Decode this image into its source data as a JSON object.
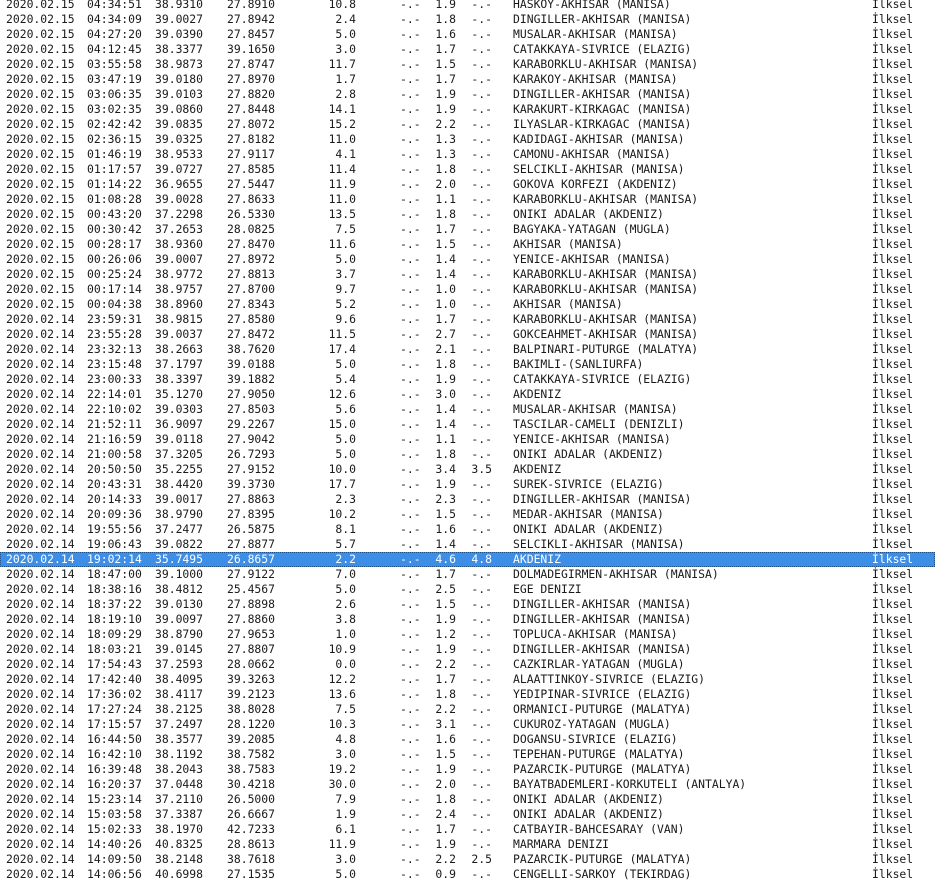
{
  "rows": [
    {
      "date": "2020.02.15",
      "time": "04:34:51",
      "lat": "38.9310",
      "lon": "27.8910",
      "depth": "10.8",
      "md": "-.-",
      "ml": "1.9",
      "mw": "-.-",
      "location": "HASKOY-AKHISAR (MANISA)",
      "type": "İlksel"
    },
    {
      "date": "2020.02.15",
      "time": "04:34:09",
      "lat": "39.0027",
      "lon": "27.8942",
      "depth": "2.4",
      "md": "-.-",
      "ml": "1.8",
      "mw": "-.-",
      "location": "DINGILLER-AKHISAR (MANISA)",
      "type": "İlksel"
    },
    {
      "date": "2020.02.15",
      "time": "04:27:20",
      "lat": "39.0390",
      "lon": "27.8457",
      "depth": "5.0",
      "md": "-.-",
      "ml": "1.6",
      "mw": "-.-",
      "location": "MUSALAR-AKHISAR (MANISA)",
      "type": "İlksel"
    },
    {
      "date": "2020.02.15",
      "time": "04:12:45",
      "lat": "38.3377",
      "lon": "39.1650",
      "depth": "3.0",
      "md": "-.-",
      "ml": "1.7",
      "mw": "-.-",
      "location": "CATAKKAYA-SIVRICE (ELAZIG)",
      "type": "İlksel"
    },
    {
      "date": "2020.02.15",
      "time": "03:55:58",
      "lat": "38.9873",
      "lon": "27.8747",
      "depth": "11.7",
      "md": "-.-",
      "ml": "1.5",
      "mw": "-.-",
      "location": "KARABORKLU-AKHISAR (MANISA)",
      "type": "İlksel"
    },
    {
      "date": "2020.02.15",
      "time": "03:47:19",
      "lat": "39.0180",
      "lon": "27.8970",
      "depth": "1.7",
      "md": "-.-",
      "ml": "1.7",
      "mw": "-.-",
      "location": "KARAKOY-AKHISAR (MANISA)",
      "type": "İlksel"
    },
    {
      "date": "2020.02.15",
      "time": "03:06:35",
      "lat": "39.0103",
      "lon": "27.8820",
      "depth": "2.8",
      "md": "-.-",
      "ml": "1.9",
      "mw": "-.-",
      "location": "DINGILLER-AKHISAR (MANISA)",
      "type": "İlksel"
    },
    {
      "date": "2020.02.15",
      "time": "03:02:35",
      "lat": "39.0860",
      "lon": "27.8448",
      "depth": "14.1",
      "md": "-.-",
      "ml": "1.9",
      "mw": "-.-",
      "location": "KARAKURT-KIRKAGAC (MANISA)",
      "type": "İlksel"
    },
    {
      "date": "2020.02.15",
      "time": "02:42:42",
      "lat": "39.0835",
      "lon": "27.8072",
      "depth": "15.2",
      "md": "-.-",
      "ml": "2.2",
      "mw": "-.-",
      "location": "ILYASLAR-KIRKAGAC (MANISA)",
      "type": "İlksel"
    },
    {
      "date": "2020.02.15",
      "time": "02:36:15",
      "lat": "39.0325",
      "lon": "27.8182",
      "depth": "11.0",
      "md": "-.-",
      "ml": "1.3",
      "mw": "-.-",
      "location": "KADIDAGI-AKHISAR (MANISA)",
      "type": "İlksel"
    },
    {
      "date": "2020.02.15",
      "time": "01:46:19",
      "lat": "38.9533",
      "lon": "27.9117",
      "depth": "4.1",
      "md": "-.-",
      "ml": "1.3",
      "mw": "-.-",
      "location": "CAMONU-AKHISAR (MANISA)",
      "type": "İlksel"
    },
    {
      "date": "2020.02.15",
      "time": "01:17:57",
      "lat": "39.0727",
      "lon": "27.8585",
      "depth": "11.4",
      "md": "-.-",
      "ml": "1.8",
      "mw": "-.-",
      "location": "SELCIKLI-AKHISAR (MANISA)",
      "type": "İlksel"
    },
    {
      "date": "2020.02.15",
      "time": "01:14:22",
      "lat": "36.9655",
      "lon": "27.5447",
      "depth": "11.9",
      "md": "-.-",
      "ml": "2.0",
      "mw": "-.-",
      "location": "GOKOVA KORFEZI (AKDENIZ)",
      "type": "İlksel"
    },
    {
      "date": "2020.02.15",
      "time": "01:08:28",
      "lat": "39.0028",
      "lon": "27.8633",
      "depth": "11.0",
      "md": "-.-",
      "ml": "1.1",
      "mw": "-.-",
      "location": "KARABORKLU-AKHISAR (MANISA)",
      "type": "İlksel"
    },
    {
      "date": "2020.02.15",
      "time": "00:43:20",
      "lat": "37.2298",
      "lon": "26.5330",
      "depth": "13.5",
      "md": "-.-",
      "ml": "1.8",
      "mw": "-.-",
      "location": "ONIKI ADALAR (AKDENIZ)",
      "type": "İlksel"
    },
    {
      "date": "2020.02.15",
      "time": "00:30:42",
      "lat": "37.2653",
      "lon": "28.0825",
      "depth": "7.5",
      "md": "-.-",
      "ml": "1.7",
      "mw": "-.-",
      "location": "BAGYAKA-YATAGAN (MUGLA)",
      "type": "İlksel"
    },
    {
      "date": "2020.02.15",
      "time": "00:28:17",
      "lat": "38.9360",
      "lon": "27.8470",
      "depth": "11.6",
      "md": "-.-",
      "ml": "1.5",
      "mw": "-.-",
      "location": "AKHISAR (MANISA)",
      "type": "İlksel"
    },
    {
      "date": "2020.02.15",
      "time": "00:26:06",
      "lat": "39.0007",
      "lon": "27.8972",
      "depth": "5.0",
      "md": "-.-",
      "ml": "1.4",
      "mw": "-.-",
      "location": "YENICE-AKHISAR (MANISA)",
      "type": "İlksel"
    },
    {
      "date": "2020.02.15",
      "time": "00:25:24",
      "lat": "38.9772",
      "lon": "27.8813",
      "depth": "3.7",
      "md": "-.-",
      "ml": "1.4",
      "mw": "-.-",
      "location": "KARABORKLU-AKHISAR (MANISA)",
      "type": "İlksel"
    },
    {
      "date": "2020.02.15",
      "time": "00:17:14",
      "lat": "38.9757",
      "lon": "27.8700",
      "depth": "9.7",
      "md": "-.-",
      "ml": "1.0",
      "mw": "-.-",
      "location": "KARABORKLU-AKHISAR (MANISA)",
      "type": "İlksel"
    },
    {
      "date": "2020.02.15",
      "time": "00:04:38",
      "lat": "38.8960",
      "lon": "27.8343",
      "depth": "5.2",
      "md": "-.-",
      "ml": "1.0",
      "mw": "-.-",
      "location": "AKHISAR (MANISA)",
      "type": "İlksel"
    },
    {
      "date": "2020.02.14",
      "time": "23:59:31",
      "lat": "38.9815",
      "lon": "27.8580",
      "depth": "9.6",
      "md": "-.-",
      "ml": "1.7",
      "mw": "-.-",
      "location": "KARABORKLU-AKHISAR (MANISA)",
      "type": "İlksel"
    },
    {
      "date": "2020.02.14",
      "time": "23:55:28",
      "lat": "39.0037",
      "lon": "27.8472",
      "depth": "11.5",
      "md": "-.-",
      "ml": "2.7",
      "mw": "-.-",
      "location": "GOKCEAHMET-AKHISAR (MANISA)",
      "type": "İlksel"
    },
    {
      "date": "2020.02.14",
      "time": "23:32:13",
      "lat": "38.2663",
      "lon": "38.7620",
      "depth": "17.4",
      "md": "-.-",
      "ml": "2.1",
      "mw": "-.-",
      "location": "BALPINARI-PUTURGE (MALATYA)",
      "type": "İlksel"
    },
    {
      "date": "2020.02.14",
      "time": "23:15:48",
      "lat": "37.1797",
      "lon": "39.0188",
      "depth": "5.0",
      "md": "-.-",
      "ml": "1.8",
      "mw": "-.-",
      "location": "BAKIMLI-(SANLIURFA)",
      "type": "İlksel"
    },
    {
      "date": "2020.02.14",
      "time": "23:00:33",
      "lat": "38.3397",
      "lon": "39.1882",
      "depth": "5.4",
      "md": "-.-",
      "ml": "1.9",
      "mw": "-.-",
      "location": "CATAKKAYA-SIVRICE (ELAZIG)",
      "type": "İlksel"
    },
    {
      "date": "2020.02.14",
      "time": "22:14:01",
      "lat": "35.1270",
      "lon": "27.9050",
      "depth": "12.6",
      "md": "-.-",
      "ml": "3.0",
      "mw": "-.-",
      "location": "AKDENIZ",
      "type": "İlksel"
    },
    {
      "date": "2020.02.14",
      "time": "22:10:02",
      "lat": "39.0303",
      "lon": "27.8503",
      "depth": "5.6",
      "md": "-.-",
      "ml": "1.4",
      "mw": "-.-",
      "location": "MUSALAR-AKHISAR (MANISA)",
      "type": "İlksel"
    },
    {
      "date": "2020.02.14",
      "time": "21:52:11",
      "lat": "36.9097",
      "lon": "29.2267",
      "depth": "15.0",
      "md": "-.-",
      "ml": "1.4",
      "mw": "-.-",
      "location": "TASCILAR-CAMELI (DENIZLI)",
      "type": "İlksel"
    },
    {
      "date": "2020.02.14",
      "time": "21:16:59",
      "lat": "39.0118",
      "lon": "27.9042",
      "depth": "5.0",
      "md": "-.-",
      "ml": "1.1",
      "mw": "-.-",
      "location": "YENICE-AKHISAR (MANISA)",
      "type": "İlksel"
    },
    {
      "date": "2020.02.14",
      "time": "21:00:58",
      "lat": "37.3205",
      "lon": "26.7293",
      "depth": "5.0",
      "md": "-.-",
      "ml": "1.8",
      "mw": "-.-",
      "location": "ONIKI ADALAR (AKDENIZ)",
      "type": "İlksel"
    },
    {
      "date": "2020.02.14",
      "time": "20:50:50",
      "lat": "35.2255",
      "lon": "27.9152",
      "depth": "10.0",
      "md": "-.-",
      "ml": "3.4",
      "mw": "3.5",
      "location": "AKDENIZ",
      "type": "İlksel"
    },
    {
      "date": "2020.02.14",
      "time": "20:43:31",
      "lat": "38.4420",
      "lon": "39.3730",
      "depth": "17.7",
      "md": "-.-",
      "ml": "1.9",
      "mw": "-.-",
      "location": "SUREK-SIVRICE (ELAZIG)",
      "type": "İlksel"
    },
    {
      "date": "2020.02.14",
      "time": "20:14:33",
      "lat": "39.0017",
      "lon": "27.8863",
      "depth": "2.3",
      "md": "-.-",
      "ml": "2.3",
      "mw": "-.-",
      "location": "DINGILLER-AKHISAR (MANISA)",
      "type": "İlksel"
    },
    {
      "date": "2020.02.14",
      "time": "20:09:36",
      "lat": "38.9790",
      "lon": "27.8395",
      "depth": "10.2",
      "md": "-.-",
      "ml": "1.5",
      "mw": "-.-",
      "location": "MEDAR-AKHISAR (MANISA)",
      "type": "İlksel"
    },
    {
      "date": "2020.02.14",
      "time": "19:55:56",
      "lat": "37.2477",
      "lon": "26.5875",
      "depth": "8.1",
      "md": "-.-",
      "ml": "1.6",
      "mw": "-.-",
      "location": "ONIKI ADALAR (AKDENIZ)",
      "type": "İlksel"
    },
    {
      "date": "2020.02.14",
      "time": "19:06:43",
      "lat": "39.0822",
      "lon": "27.8877",
      "depth": "5.7",
      "md": "-.-",
      "ml": "1.4",
      "mw": "-.-",
      "location": "SELCIKLI-AKHISAR (MANISA)",
      "type": "İlksel"
    },
    {
      "date": "2020.02.14",
      "time": "19:02:14",
      "lat": "35.7495",
      "lon": "26.8657",
      "depth": "2.2",
      "md": "-.-",
      "ml": "4.6",
      "mw": "4.8",
      "location": "AKDENIZ",
      "type": "İlksel",
      "selected": true
    },
    {
      "date": "2020.02.14",
      "time": "18:47:00",
      "lat": "39.1000",
      "lon": "27.9122",
      "depth": "7.0",
      "md": "-.-",
      "ml": "1.7",
      "mw": "-.-",
      "location": "DOLMADEGIRMEN-AKHISAR (MANISA)",
      "type": "İlksel"
    },
    {
      "date": "2020.02.14",
      "time": "18:38:16",
      "lat": "38.4812",
      "lon": "25.4567",
      "depth": "5.0",
      "md": "-.-",
      "ml": "2.5",
      "mw": "-.-",
      "location": "EGE DENIZI",
      "type": "İlksel"
    },
    {
      "date": "2020.02.14",
      "time": "18:37:22",
      "lat": "39.0130",
      "lon": "27.8898",
      "depth": "2.6",
      "md": "-.-",
      "ml": "1.5",
      "mw": "-.-",
      "location": "DINGILLER-AKHISAR (MANISA)",
      "type": "İlksel"
    },
    {
      "date": "2020.02.14",
      "time": "18:19:10",
      "lat": "39.0097",
      "lon": "27.8860",
      "depth": "3.8",
      "md": "-.-",
      "ml": "1.9",
      "mw": "-.-",
      "location": "DINGILLER-AKHISAR (MANISA)",
      "type": "İlksel"
    },
    {
      "date": "2020.02.14",
      "time": "18:09:29",
      "lat": "38.8790",
      "lon": "27.9653",
      "depth": "1.0",
      "md": "-.-",
      "ml": "1.2",
      "mw": "-.-",
      "location": "TOPLUCA-AKHISAR (MANISA)",
      "type": "İlksel"
    },
    {
      "date": "2020.02.14",
      "time": "18:03:21",
      "lat": "39.0145",
      "lon": "27.8807",
      "depth": "10.9",
      "md": "-.-",
      "ml": "1.9",
      "mw": "-.-",
      "location": "DINGILLER-AKHISAR (MANISA)",
      "type": "İlksel"
    },
    {
      "date": "2020.02.14",
      "time": "17:54:43",
      "lat": "37.2593",
      "lon": "28.0662",
      "depth": "0.0",
      "md": "-.-",
      "ml": "2.2",
      "mw": "-.-",
      "location": "CAZKIRLAR-YATAGAN (MUGLA)",
      "type": "İlksel"
    },
    {
      "date": "2020.02.14",
      "time": "17:42:40",
      "lat": "38.4095",
      "lon": "39.3263",
      "depth": "12.2",
      "md": "-.-",
      "ml": "1.7",
      "mw": "-.-",
      "location": "ALAATTINKOY-SIVRICE (ELAZIG)",
      "type": "İlksel"
    },
    {
      "date": "2020.02.14",
      "time": "17:36:02",
      "lat": "38.4117",
      "lon": "39.2123",
      "depth": "13.6",
      "md": "-.-",
      "ml": "1.8",
      "mw": "-.-",
      "location": "YEDIPINAR-SIVRICE (ELAZIG)",
      "type": "İlksel"
    },
    {
      "date": "2020.02.14",
      "time": "17:27:24",
      "lat": "38.2125",
      "lon": "38.8028",
      "depth": "7.5",
      "md": "-.-",
      "ml": "2.2",
      "mw": "-.-",
      "location": "ORMANICI-PUTURGE (MALATYA)",
      "type": "İlksel"
    },
    {
      "date": "2020.02.14",
      "time": "17:15:57",
      "lat": "37.2497",
      "lon": "28.1220",
      "depth": "10.3",
      "md": "-.-",
      "ml": "3.1",
      "mw": "-.-",
      "location": "CUKUROZ-YATAGAN (MUGLA)",
      "type": "İlksel"
    },
    {
      "date": "2020.02.14",
      "time": "16:44:50",
      "lat": "38.3577",
      "lon": "39.2085",
      "depth": "4.8",
      "md": "-.-",
      "ml": "1.6",
      "mw": "-.-",
      "location": "DOGANSU-SIVRICE (ELAZIG)",
      "type": "İlksel"
    },
    {
      "date": "2020.02.14",
      "time": "16:42:10",
      "lat": "38.1192",
      "lon": "38.7582",
      "depth": "3.0",
      "md": "-.-",
      "ml": "1.5",
      "mw": "-.-",
      "location": "TEPEHAN-PUTURGE (MALATYA)",
      "type": "İlksel"
    },
    {
      "date": "2020.02.14",
      "time": "16:39:48",
      "lat": "38.2043",
      "lon": "38.7583",
      "depth": "19.2",
      "md": "-.-",
      "ml": "1.9",
      "mw": "-.-",
      "location": "PAZARCIK-PUTURGE (MALATYA)",
      "type": "İlksel"
    },
    {
      "date": "2020.02.14",
      "time": "16:20:37",
      "lat": "37.0448",
      "lon": "30.4218",
      "depth": "30.0",
      "md": "-.-",
      "ml": "2.0",
      "mw": "-.-",
      "location": "BAYATBADEMLERI-KORKUTELI (ANTALYA)",
      "type": "İlksel"
    },
    {
      "date": "2020.02.14",
      "time": "15:23:14",
      "lat": "37.2110",
      "lon": "26.5000",
      "depth": "7.9",
      "md": "-.-",
      "ml": "1.8",
      "mw": "-.-",
      "location": "ONIKI ADALAR (AKDENIZ)",
      "type": "İlksel"
    },
    {
      "date": "2020.02.14",
      "time": "15:03:58",
      "lat": "37.3387",
      "lon": "26.6667",
      "depth": "1.9",
      "md": "-.-",
      "ml": "2.4",
      "mw": "-.-",
      "location": "ONIKI ADALAR (AKDENIZ)",
      "type": "İlksel"
    },
    {
      "date": "2020.02.14",
      "time": "15:02:33",
      "lat": "38.1970",
      "lon": "42.7233",
      "depth": "6.1",
      "md": "-.-",
      "ml": "1.7",
      "mw": "-.-",
      "location": "CATBAYIR-BAHCESARAY (VAN)",
      "type": "İlksel"
    },
    {
      "date": "2020.02.14",
      "time": "14:40:26",
      "lat": "40.8325",
      "lon": "28.8613",
      "depth": "11.9",
      "md": "-.-",
      "ml": "1.9",
      "mw": "-.-",
      "location": "MARMARA DENIZI",
      "type": "İlksel"
    },
    {
      "date": "2020.02.14",
      "time": "14:09:50",
      "lat": "38.2148",
      "lon": "38.7618",
      "depth": "3.0",
      "md": "-.-",
      "ml": "2.2",
      "mw": "2.5",
      "location": "PAZARCIK-PUTURGE (MALATYA)",
      "type": "İlksel"
    },
    {
      "date": "2020.02.14",
      "time": "14:06:56",
      "lat": "40.6998",
      "lon": "27.1535",
      "depth": "5.0",
      "md": "-.-",
      "ml": "0.9",
      "mw": "-.-",
      "location": "CENGELLI-SARKOY (TEKIRDAG)",
      "type": "İlksel"
    }
  ]
}
